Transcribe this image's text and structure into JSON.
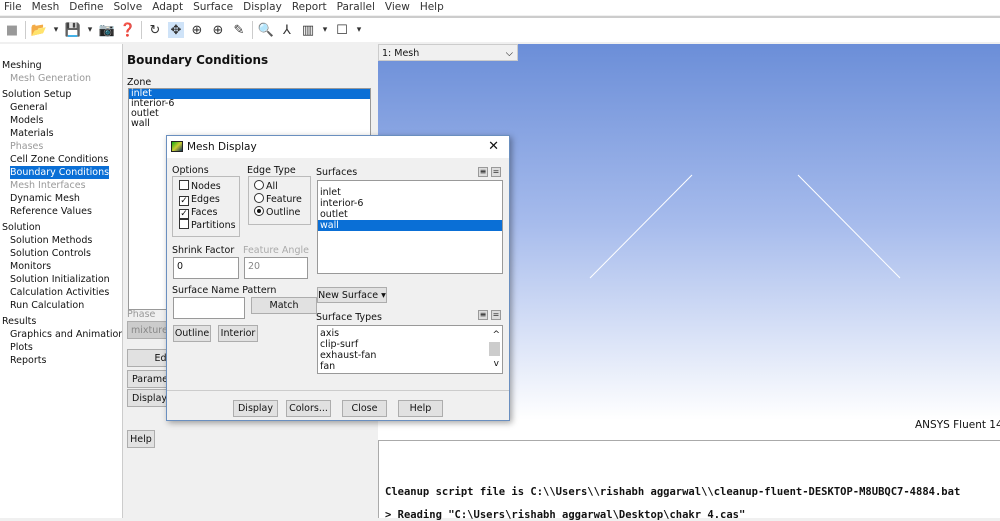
{
  "menu": [
    "File",
    "Mesh",
    "Define",
    "Solve",
    "Adapt",
    "Surface",
    "Display",
    "Report",
    "Parallel",
    "View",
    "Help"
  ],
  "toolbar": {
    "icons": [
      "gray-box-icon",
      "open-folder-icon",
      "dropdown-icon",
      "save-icon",
      "dropdown-icon",
      "camera-icon",
      "help-icon",
      "rotate-icon",
      "pan-icon",
      "zoom-in-icon",
      "zoom-box-icon",
      "probe-icon",
      "zoom-fit-icon",
      "axes-icon",
      "layout-icon",
      "dropdown-icon",
      "window-icon",
      "dropdown-icon"
    ]
  },
  "tree": [
    {
      "label": "Meshing",
      "type": "h"
    },
    {
      "label": "Mesh Generation",
      "type": "i",
      "disabled": true
    },
    {
      "label": "Solution Setup",
      "type": "h"
    },
    {
      "label": "General",
      "type": "i"
    },
    {
      "label": "Models",
      "type": "i"
    },
    {
      "label": "Materials",
      "type": "i"
    },
    {
      "label": "Phases",
      "type": "i",
      "disabled": true
    },
    {
      "label": "Cell Zone Conditions",
      "type": "i"
    },
    {
      "label": "Boundary Conditions",
      "type": "i",
      "selected": true
    },
    {
      "label": "Mesh Interfaces",
      "type": "i",
      "disabled": true
    },
    {
      "label": "Dynamic Mesh",
      "type": "i"
    },
    {
      "label": "Reference Values",
      "type": "i"
    },
    {
      "label": "Solution",
      "type": "h"
    },
    {
      "label": "Solution Methods",
      "type": "i"
    },
    {
      "label": "Solution Controls",
      "type": "i"
    },
    {
      "label": "Monitors",
      "type": "i"
    },
    {
      "label": "Solution Initialization",
      "type": "i"
    },
    {
      "label": "Calculation Activities",
      "type": "i"
    },
    {
      "label": "Run Calculation",
      "type": "i"
    },
    {
      "label": "Results",
      "type": "h"
    },
    {
      "label": "Graphics and Animations",
      "type": "i"
    },
    {
      "label": "Plots",
      "type": "i"
    },
    {
      "label": "Reports",
      "type": "i"
    }
  ],
  "panel": {
    "title": "Boundary Conditions",
    "zone_label": "Zone",
    "zones": [
      "inlet",
      "interior-6",
      "outlet",
      "wall"
    ],
    "selected_zone": "inlet",
    "phase_label": "Phase",
    "phase_value": "mixture",
    "edit": "Edit...",
    "parameters": "Parameters...",
    "display_mesh": "Display Mesh...",
    "help": "Help"
  },
  "graphics": {
    "window_label": "1: Mesh",
    "watermark": "ANSYS Fluent 14",
    "bg_top": "#6b8ed8"
  },
  "console": [
    "Cleanup script file is C:\\\\Users\\\\rishabh aggarwal\\\\cleanup-fluent-DESKTOP-M8UBQC7-4884.bat",
    "> Reading \"C:\\Users\\rishabh aggarwal\\Desktop\\chakr 4.cas\""
  ],
  "dialog": {
    "title": "Mesh Display",
    "options_label": "Options",
    "options": [
      {
        "label": "Nodes",
        "checked": false
      },
      {
        "label": "Edges",
        "checked": true
      },
      {
        "label": "Faces",
        "checked": true
      },
      {
        "label": "Partitions",
        "checked": false
      }
    ],
    "edge_type_label": "Edge Type",
    "edge_types": [
      {
        "label": "All",
        "selected": false
      },
      {
        "label": "Feature",
        "selected": false
      },
      {
        "label": "Outline",
        "selected": true
      }
    ],
    "shrink_label": "Shrink Factor",
    "shrink_value": "0",
    "feature_angle_label": "Feature Angle",
    "feature_angle_value": "20",
    "pattern_label": "Surface Name Pattern",
    "pattern_value": "",
    "match": "Match",
    "outline": "Outline",
    "interior": "Interior",
    "surfaces_label": "Surfaces",
    "surfaces": [
      "inlet",
      "interior-6",
      "outlet",
      "wall"
    ],
    "selected_surface": "wall",
    "new_surface": "New Surface ▾",
    "surface_types_label": "Surface Types",
    "surface_types": [
      "axis",
      "clip-surf",
      "exhaust-fan",
      "fan"
    ],
    "buttons": {
      "display": "Display",
      "colors": "Colors...",
      "close": "Close",
      "help": "Help"
    }
  }
}
